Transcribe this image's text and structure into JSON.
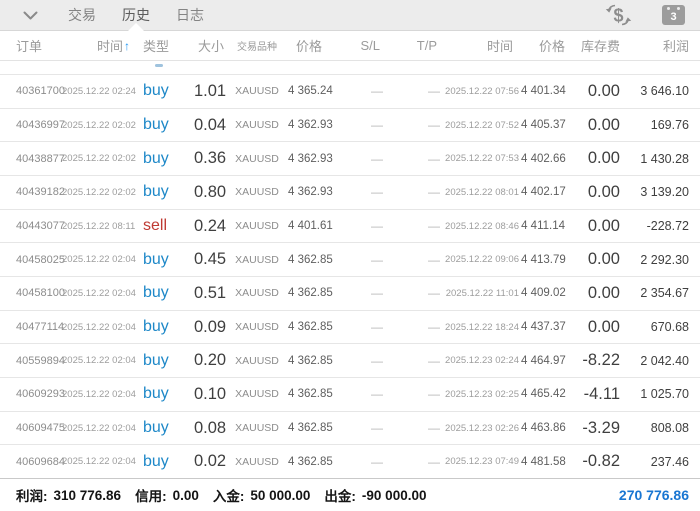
{
  "topbar": {
    "tabs": [
      {
        "label": "交易",
        "active": false
      },
      {
        "label": "历史",
        "active": true
      },
      {
        "label": "日志",
        "active": false
      }
    ],
    "calendar_badge": "3"
  },
  "table": {
    "headers": [
      "订单",
      "时间",
      "类型",
      "大小",
      "交易品种",
      "价格",
      "S/L",
      "T/P",
      "时间",
      "价格",
      "库存费",
      "利润"
    ],
    "sort_icon": "↑",
    "rows": [
      {
        "order": "40361700",
        "open_time": "2025.12.22 02:24",
        "type": "buy",
        "size": "1.01",
        "symbol": "XAUUSD",
        "open_price": "4 365.24",
        "sl": "—",
        "tp": "—",
        "close_time": "2025.12.22 07:56",
        "close_price": "4 401.34",
        "swap": "0.00",
        "profit": "3 646.10"
      },
      {
        "order": "40436997",
        "open_time": "2025.12.22 02:02",
        "type": "buy",
        "size": "0.04",
        "symbol": "XAUUSD",
        "open_price": "4 362.93",
        "sl": "—",
        "tp": "—",
        "close_time": "2025.12.22 07:52",
        "close_price": "4 405.37",
        "swap": "0.00",
        "profit": "169.76"
      },
      {
        "order": "40438877",
        "open_time": "2025.12.22 02:02",
        "type": "buy",
        "size": "0.36",
        "symbol": "XAUUSD",
        "open_price": "4 362.93",
        "sl": "—",
        "tp": "—",
        "close_time": "2025.12.22 07:53",
        "close_price": "4 402.66",
        "swap": "0.00",
        "profit": "1 430.28"
      },
      {
        "order": "40439182",
        "open_time": "2025.12.22 02:02",
        "type": "buy",
        "size": "0.80",
        "symbol": "XAUUSD",
        "open_price": "4 362.93",
        "sl": "—",
        "tp": "—",
        "close_time": "2025.12.22 08:01",
        "close_price": "4 402.17",
        "swap": "0.00",
        "profit": "3 139.20"
      },
      {
        "order": "40443077",
        "open_time": "2025.12.22 08:11",
        "type": "sell",
        "size": "0.24",
        "symbol": "XAUUSD",
        "open_price": "4 401.61",
        "sl": "—",
        "tp": "—",
        "close_time": "2025.12.22 08:46",
        "close_price": "4 411.14",
        "swap": "0.00",
        "profit": "-228.72"
      },
      {
        "order": "40458025",
        "open_time": "2025.12.22 02:04",
        "type": "buy",
        "size": "0.45",
        "symbol": "XAUUSD",
        "open_price": "4 362.85",
        "sl": "—",
        "tp": "—",
        "close_time": "2025.12.22 09:06",
        "close_price": "4 413.79",
        "swap": "0.00",
        "profit": "2 292.30"
      },
      {
        "order": "40458100",
        "open_time": "2025.12.22 02:04",
        "type": "buy",
        "size": "0.51",
        "symbol": "XAUUSD",
        "open_price": "4 362.85",
        "sl": "—",
        "tp": "—",
        "close_time": "2025.12.22 11:01",
        "close_price": "4 409.02",
        "swap": "0.00",
        "profit": "2 354.67"
      },
      {
        "order": "40477114",
        "open_time": "2025.12.22 02:04",
        "type": "buy",
        "size": "0.09",
        "symbol": "XAUUSD",
        "open_price": "4 362.85",
        "sl": "—",
        "tp": "—",
        "close_time": "2025.12.22 18:24",
        "close_price": "4 437.37",
        "swap": "0.00",
        "profit": "670.68"
      },
      {
        "order": "40559894",
        "open_time": "2025.12.22 02:04",
        "type": "buy",
        "size": "0.20",
        "symbol": "XAUUSD",
        "open_price": "4 362.85",
        "sl": "—",
        "tp": "—",
        "close_time": "2025.12.23 02:24",
        "close_price": "4 464.97",
        "swap": "-8.22",
        "profit": "2 042.40"
      },
      {
        "order": "40609293",
        "open_time": "2025.12.22 02:04",
        "type": "buy",
        "size": "0.10",
        "symbol": "XAUUSD",
        "open_price": "4 362.85",
        "sl": "—",
        "tp": "—",
        "close_time": "2025.12.23 02:25",
        "close_price": "4 465.42",
        "swap": "-4.11",
        "profit": "1 025.70"
      },
      {
        "order": "40609475",
        "open_time": "2025.12.22 02:04",
        "type": "buy",
        "size": "0.08",
        "symbol": "XAUUSD",
        "open_price": "4 362.85",
        "sl": "—",
        "tp": "—",
        "close_time": "2025.12.23 02:26",
        "close_price": "4 463.86",
        "swap": "-3.29",
        "profit": "808.08"
      },
      {
        "order": "40609684",
        "open_time": "2025.12.22 02:04",
        "type": "buy",
        "size": "0.02",
        "symbol": "XAUUSD",
        "open_price": "4 362.85",
        "sl": "—",
        "tp": "—",
        "close_time": "2025.12.23 07:49",
        "close_price": "4 481.58",
        "swap": "-0.82",
        "profit": "237.46"
      }
    ]
  },
  "summary": {
    "profit_label": "利润:",
    "profit": "310 776.86",
    "credit_label": "信用:",
    "credit": "0.00",
    "deposit_label": "入金:",
    "deposit": "50 000.00",
    "withdrawal_label": "出金:",
    "withdrawal": "-90 000.00",
    "balance": "270 776.86"
  },
  "colors": {
    "buy": "#1e88c8",
    "sell": "#bf3a33",
    "sort_arrow": "#2196f3",
    "balance": "#1976d2"
  }
}
